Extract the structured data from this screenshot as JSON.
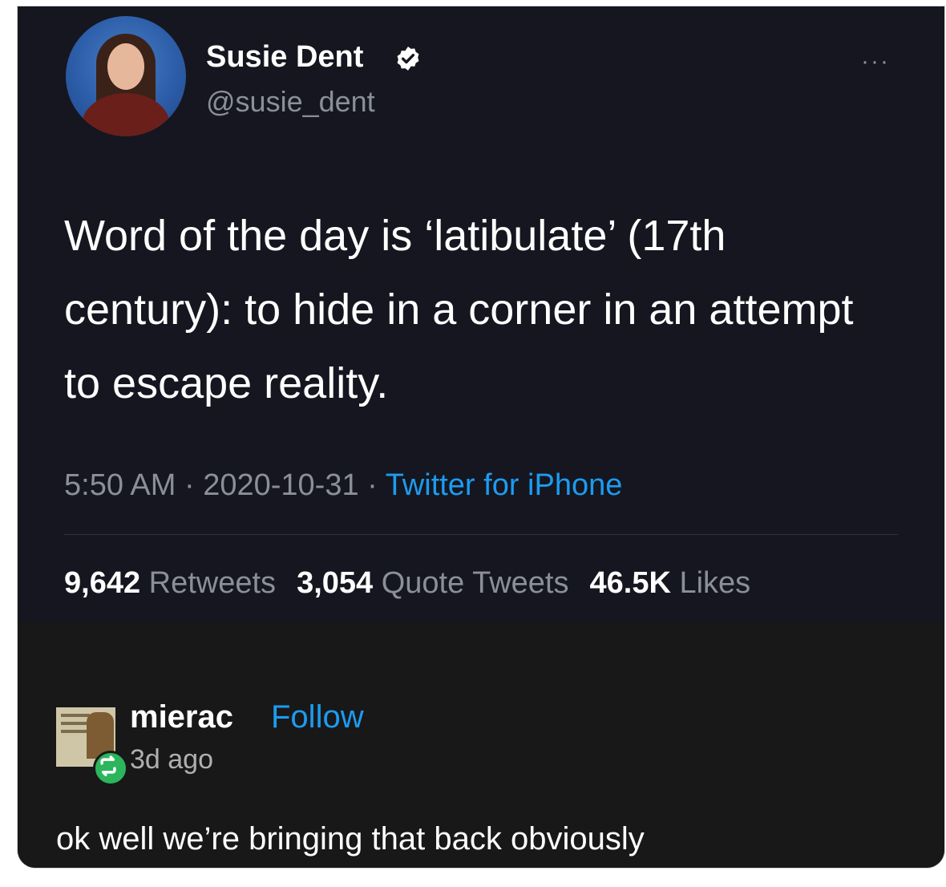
{
  "tweet": {
    "author_name": "Susie Dent",
    "handle": "@susie_dent",
    "text": "Word of the day is ‘latibulate’ (17th century): to hide in a corner in an attempt to escape reality.",
    "time": "5:50 AM",
    "date": "2020-10-31",
    "source": "Twitter for iPhone",
    "retweets_count": "9,642",
    "retweets_label": "Retweets",
    "quotes_count": "3,054",
    "quotes_label": "Quote Tweets",
    "likes_count": "46.5K",
    "likes_label": "Likes",
    "more_label": "···"
  },
  "reply": {
    "username": "mierac",
    "follow_label": "Follow",
    "time_ago": "3d ago",
    "text": "ok well we’re bringing that back obviously"
  },
  "colors": {
    "tweet_background": "#15161f",
    "reply_background": "#181818",
    "link_blue": "#1d9bf0",
    "muted_text": "#8b8f99",
    "reblog_green": "#2cb55c"
  },
  "icons": {
    "verified": "verified-badge-icon",
    "more": "more-options-icon",
    "reblog": "reblog-icon"
  }
}
